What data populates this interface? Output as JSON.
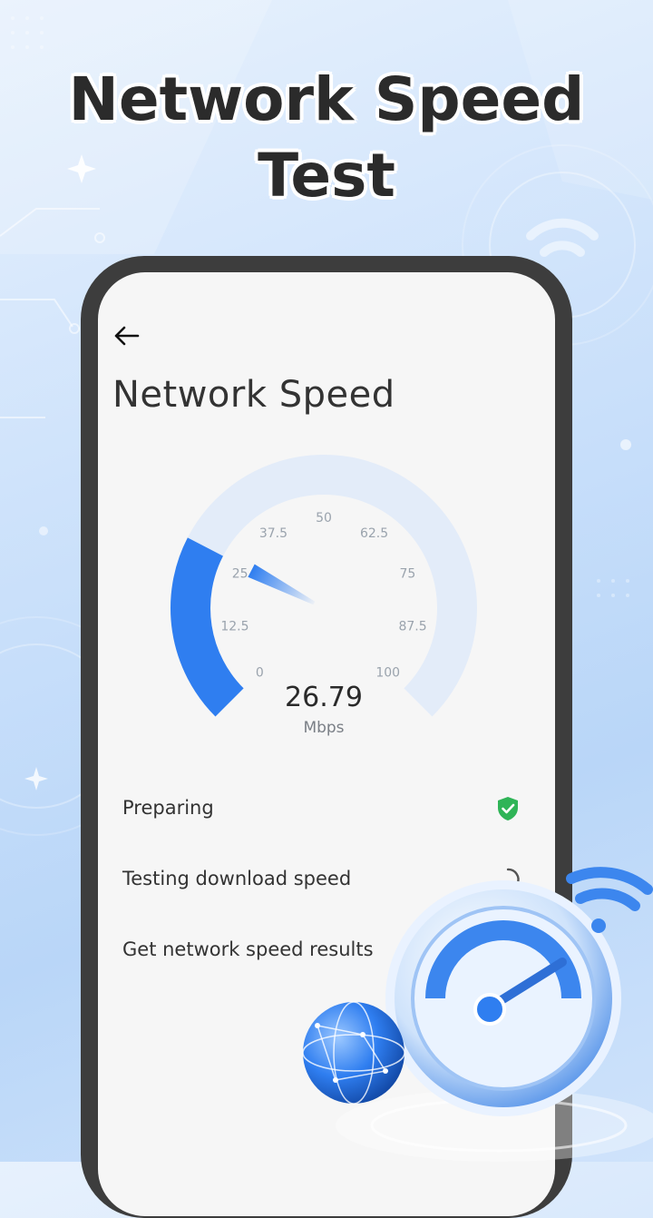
{
  "promo": {
    "title_line1": "Network Speed",
    "title_line2": "Test"
  },
  "app": {
    "back_icon": "arrow-left-icon",
    "page_title": "Network Speed"
  },
  "gauge": {
    "value": "26.79",
    "unit": "Mbps",
    "current_value": 26.79,
    "max": 100,
    "ticks": [
      "0",
      "12.5",
      "25",
      "37.5",
      "50",
      "62.5",
      "75",
      "87.5",
      "100"
    ],
    "colors": {
      "fill": "#2f7ef0",
      "track": "#e3ecf9",
      "tick_label": "#9aa3ad"
    }
  },
  "steps": [
    {
      "label": "Preparing",
      "status": "done",
      "icon": "green-shield-check-icon"
    },
    {
      "label": "Testing download speed",
      "status": "in-progress",
      "icon": "loading-spinner-icon"
    },
    {
      "label": "Get network speed results",
      "status": "pending",
      "icon": ""
    }
  ],
  "colors": {
    "success": "#2fb457",
    "accent": "#2f7ef0"
  }
}
